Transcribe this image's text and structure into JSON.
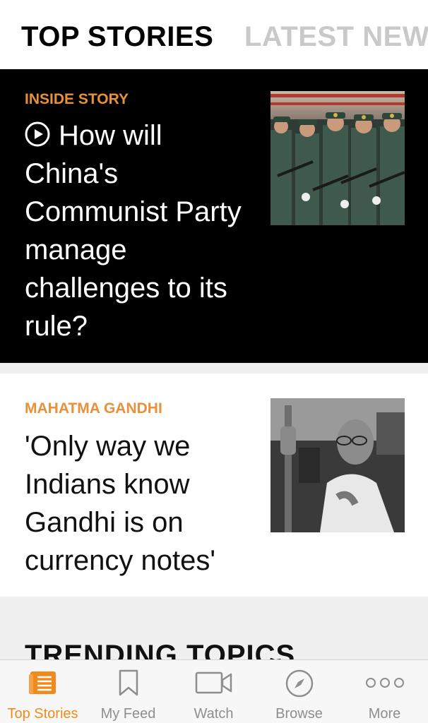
{
  "header": {
    "tabs": [
      {
        "label": "TOP STORIES",
        "active": true
      },
      {
        "label": "LATEST NEWS",
        "active": false
      }
    ]
  },
  "stories": [
    {
      "kicker": "INSIDE STORY",
      "headline": "How will China's Communist Party manage challenges to its rule?",
      "has_video": true,
      "thumbnail": "soldiers-marching-photo"
    },
    {
      "kicker": "MAHATMA GANDHI",
      "headline": "'Only way we Indians know Gandhi is on currency notes'",
      "has_video": false,
      "thumbnail": "gandhi-photo"
    }
  ],
  "trending": {
    "title": "TRENDING TOPICS"
  },
  "tabbar": {
    "items": [
      {
        "label": "Top Stories",
        "icon": "top-stories-icon",
        "active": true
      },
      {
        "label": "My Feed",
        "icon": "bookmark-icon",
        "active": false
      },
      {
        "label": "Watch",
        "icon": "video-camera-icon",
        "active": false
      },
      {
        "label": "Browse",
        "icon": "compass-icon",
        "active": false
      },
      {
        "label": "More",
        "icon": "more-dots-icon",
        "active": false
      }
    ]
  },
  "colors": {
    "accent": "#f08a1d",
    "kicker": "#e8913a",
    "inactive_tab": "#c9c9c9"
  }
}
